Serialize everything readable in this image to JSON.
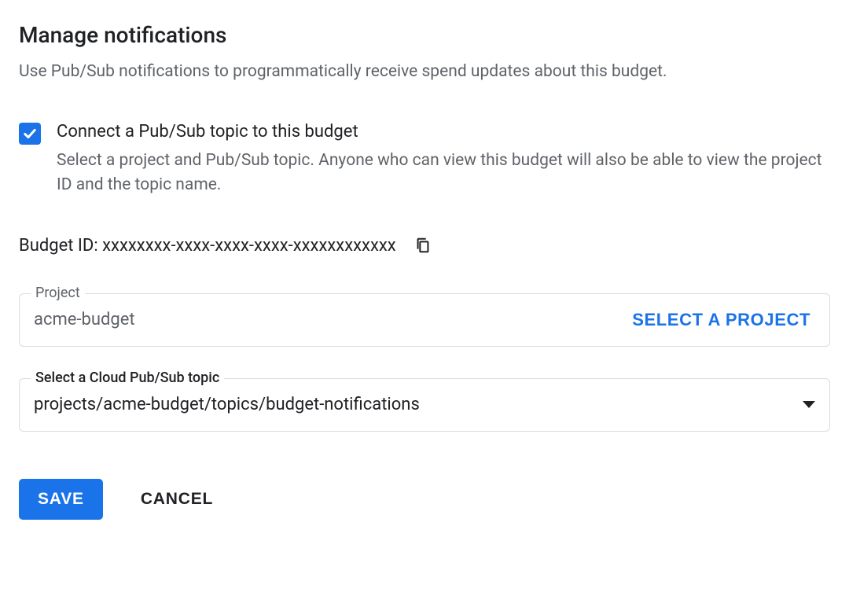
{
  "header": {
    "title": "Manage notifications",
    "subtitle": "Use Pub/Sub notifications to programmatically receive spend updates about this budget."
  },
  "checkbox": {
    "label": "Connect a Pub/Sub topic to this budget",
    "description": "Select a project and Pub/Sub topic. Anyone who can view this budget will also be able to view the project ID and the topic name."
  },
  "budget_id": {
    "label_prefix": "Budget ID: ",
    "value": "xxxxxxxx-xxxx-xxxx-xxxx-xxxxxxxxxxxx"
  },
  "project_field": {
    "legend": "Project",
    "value": "acme-budget",
    "select_button": "SELECT A PROJECT"
  },
  "topic_field": {
    "legend": "Select a Cloud Pub/Sub topic",
    "value": "projects/acme-budget/topics/budget-notifications"
  },
  "buttons": {
    "save": "SAVE",
    "cancel": "CANCEL"
  }
}
